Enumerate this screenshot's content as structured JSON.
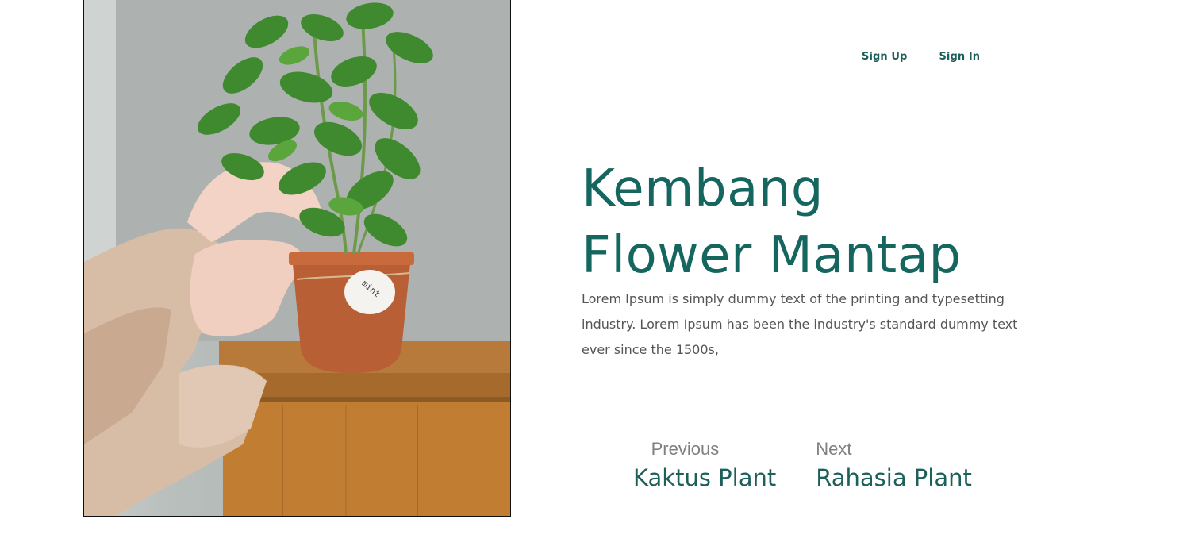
{
  "nav": {
    "sign_up": "Sign Up",
    "sign_in": "Sign In"
  },
  "hero": {
    "title_line1": "Kembang",
    "title_line2": "Flower Mantap",
    "description": "Lorem Ipsum is simply dummy text of the printing and typesetting industry. Lorem Ipsum has been the industry's standard dummy text ever since the 1500s,",
    "image_alt": "mint plant in terracotta pot",
    "pot_tag_text": "mint"
  },
  "pager": {
    "previous_label": "Previous",
    "previous_name": "Kaktus Plant",
    "next_label": "Next",
    "next_name": "Rahasia Plant"
  },
  "colors": {
    "accent": "#166660",
    "body_text": "#555555",
    "muted": "#808080"
  }
}
